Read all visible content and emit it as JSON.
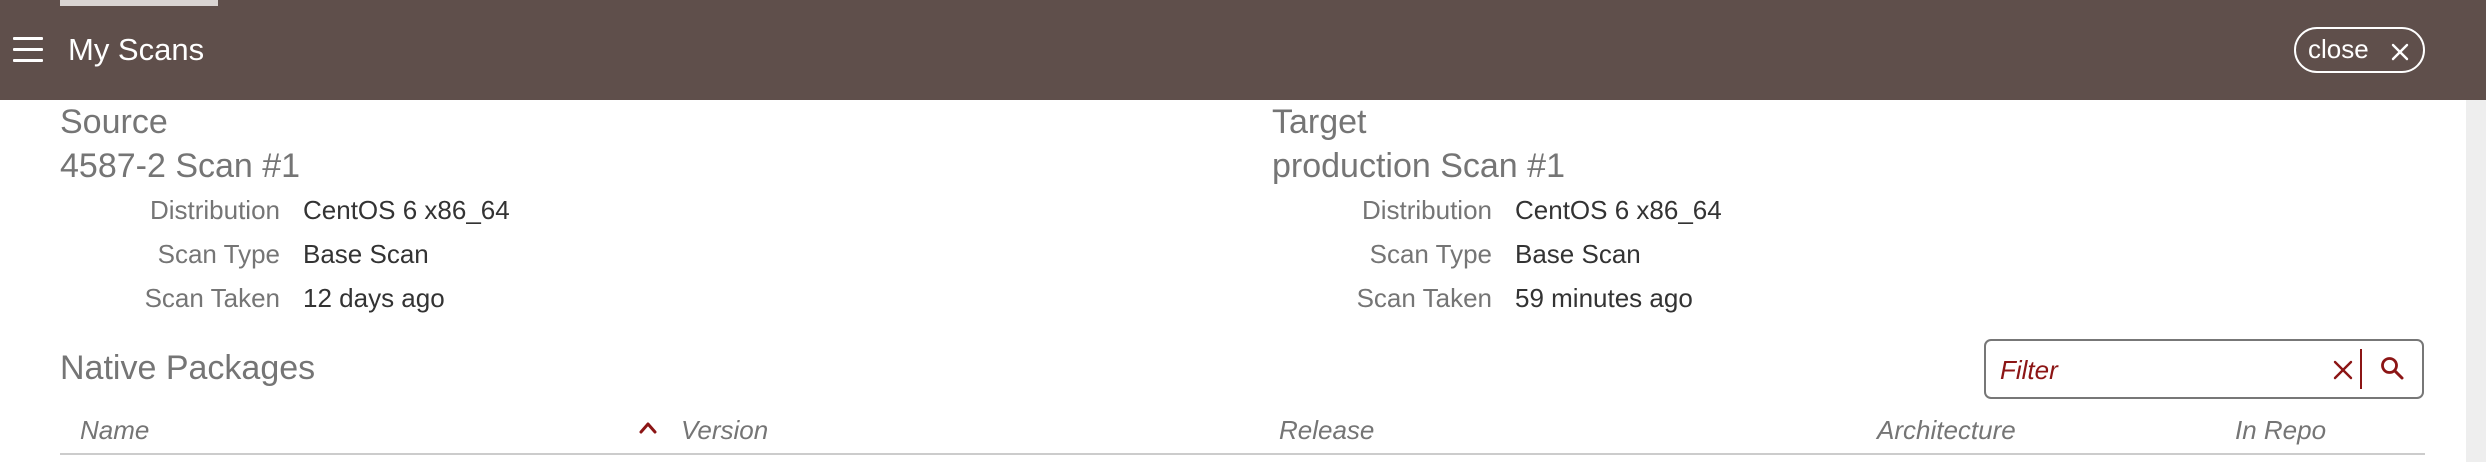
{
  "header": {
    "title": "My Scans",
    "close_label": "close"
  },
  "source": {
    "heading": "Source",
    "name": "4587-2 Scan #1",
    "details": [
      {
        "label": "Distribution",
        "value": "CentOS 6 x86_64"
      },
      {
        "label": "Scan Type",
        "value": "Base Scan"
      },
      {
        "label": "Scan Taken",
        "value": "12 days ago"
      }
    ]
  },
  "target": {
    "heading": "Target",
    "name": "production Scan #1",
    "details": [
      {
        "label": "Distribution",
        "value": "CentOS 6 x86_64"
      },
      {
        "label": "Scan Type",
        "value": "Base Scan"
      },
      {
        "label": "Scan Taken",
        "value": "59 minutes ago"
      }
    ]
  },
  "packages": {
    "title": "Native Packages",
    "filter_placeholder": "Filter",
    "filter_value": "",
    "columns": [
      "Name",
      "Version",
      "Release",
      "Architecture",
      "In Repo"
    ],
    "sort_column": "Name",
    "sort_direction": "ascending"
  },
  "colors": {
    "header_background": "#5f4f4b",
    "accent": "#8c1515",
    "muted_text": "#757575"
  },
  "icons": {
    "menu": "hamburger-menu-icon",
    "close": "close-x-icon",
    "filter_clear": "clear-x-icon",
    "search": "magnifier-search-icon",
    "sort": "chevron-up-icon"
  }
}
